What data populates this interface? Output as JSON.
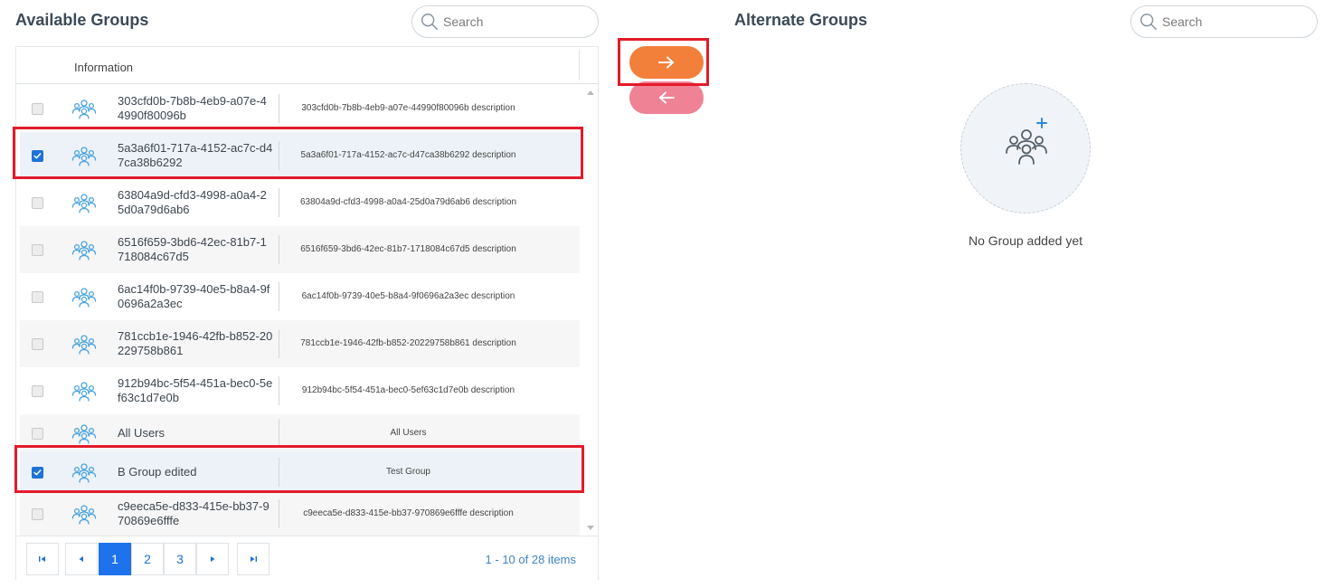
{
  "available": {
    "title": "Available Groups",
    "search_placeholder": "Search",
    "column_header": "Information",
    "rows": [
      {
        "name": "303cfd0b-7b8b-4eb9-a07e-44990f80096b",
        "description": "303cfd0b-7b8b-4eb9-a07e-44990f80096b description",
        "checked": false
      },
      {
        "name": "5a3a6f01-717a-4152-ac7c-d47ca38b6292",
        "description": "5a3a6f01-717a-4152-ac7c-d47ca38b6292 description",
        "checked": true
      },
      {
        "name": "63804a9d-cfd3-4998-a0a4-25d0a79d6ab6",
        "description": "63804a9d-cfd3-4998-a0a4-25d0a79d6ab6 description",
        "checked": false
      },
      {
        "name": "6516f659-3bd6-42ec-81b7-1718084c67d5",
        "description": "6516f659-3bd6-42ec-81b7-1718084c67d5 description",
        "checked": false
      },
      {
        "name": "6ac14f0b-9739-40e5-b8a4-9f0696a2a3ec",
        "description": "6ac14f0b-9739-40e5-b8a4-9f0696a2a3ec description",
        "checked": false
      },
      {
        "name": "781ccb1e-1946-42fb-b852-20229758b861",
        "description": "781ccb1e-1946-42fb-b852-20229758b861 description",
        "checked": false
      },
      {
        "name": "912b94bc-5f54-451a-bec0-5ef63c1d7e0b",
        "description": "912b94bc-5f54-451a-bec0-5ef63c1d7e0b description",
        "checked": false
      },
      {
        "name": "All Users",
        "description": "All Users",
        "checked": false
      },
      {
        "name": "B Group edited",
        "description": "Test Group",
        "checked": true
      },
      {
        "name": "c9eeca5e-d833-415e-bb37-970869e6fffe",
        "description": "c9eeca5e-d833-415e-bb37-970869e6fffe description",
        "checked": false
      }
    ],
    "pager": {
      "pages": [
        "1",
        "2",
        "3"
      ],
      "current": "1",
      "info": "1 - 10 of 28 items"
    }
  },
  "alternate": {
    "title": "Alternate Groups",
    "search_placeholder": "Search",
    "empty_text": "No Group added yet"
  },
  "icons": {
    "search": "search-icon",
    "group": "user-group-icon",
    "add_group": "add-group-icon",
    "arrow_right": "arrow-right-icon",
    "arrow_left": "arrow-left-icon"
  },
  "colors": {
    "accent": "#1e73ec",
    "move_right": "#f27f3a",
    "move_left": "#ef8295",
    "highlight_frame": "#e21b2a",
    "group_icon": "#4aa3df"
  }
}
